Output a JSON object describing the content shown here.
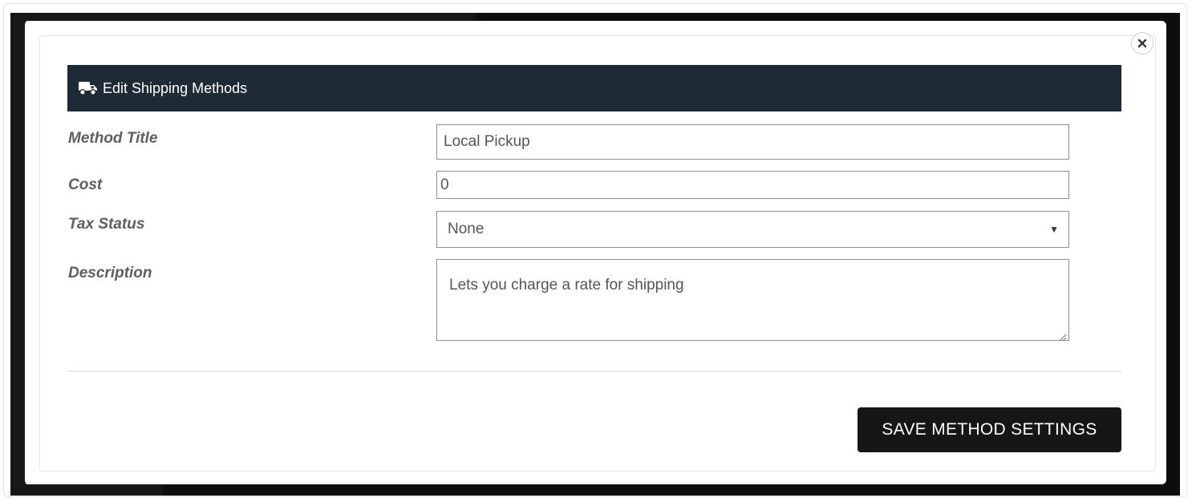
{
  "modal": {
    "header_title": "Edit Shipping Methods",
    "header_icon": "truck-icon",
    "close_icon": "close-icon"
  },
  "form": {
    "method_title": {
      "label": "Method Title",
      "value": "Local Pickup"
    },
    "cost": {
      "label": "Cost",
      "value": "0"
    },
    "tax_status": {
      "label": "Tax Status",
      "selected": "None"
    },
    "description": {
      "label": "Description",
      "value": "Lets you charge a rate for shipping"
    }
  },
  "footer": {
    "save_label": "SAVE METHOD SETTINGS"
  },
  "colors": {
    "header_bg": "#1e2a35",
    "button_bg": "#161616",
    "label_text": "#5e5e5e"
  }
}
